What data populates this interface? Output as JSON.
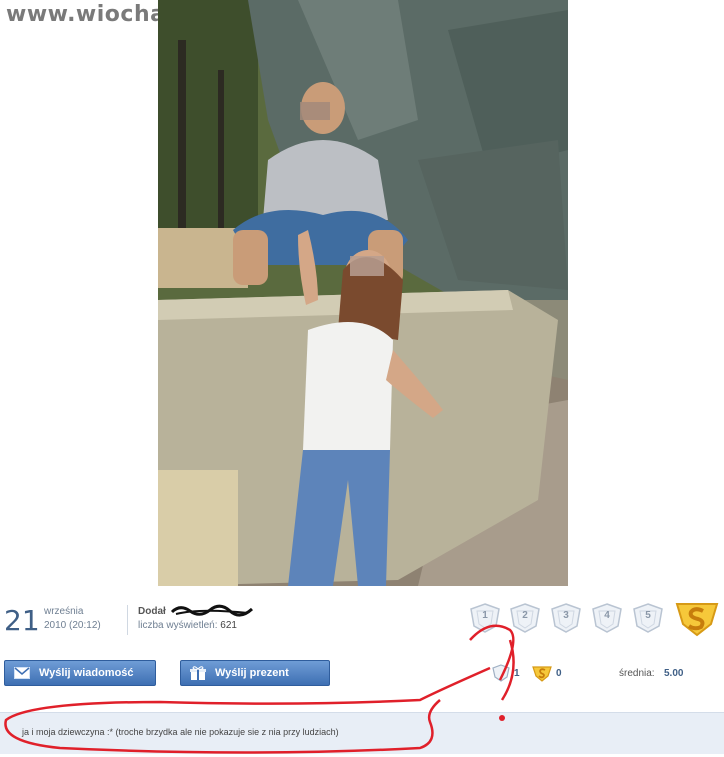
{
  "watermark": "www.wiocha.pl",
  "post": {
    "day": "21",
    "month": "września",
    "datetime": "2010 (20:12)",
    "added_label": "Dodał",
    "views_label": "liczba wyświetleń:",
    "views_count": "621"
  },
  "rating": {
    "stars": [
      "1",
      "2",
      "3",
      "4",
      "5"
    ],
    "star_icon": "shield-star-icon",
    "super_icon": "super-s-icon",
    "star_count": "1",
    "super_count": "0",
    "average_label": "średnia:",
    "average_value": "5.00"
  },
  "actions": {
    "send_message": "Wyślij wiadomość",
    "send_gift": "Wyślij prezent"
  },
  "caption": "ja i moja dziewczyna :* (troche brzydka ale nie pokazuje sie z nia przy ludziach)",
  "colors": {
    "accent": "#3e6fb3",
    "annotation": "#e0202a",
    "caption_bg": "#e8eef6"
  }
}
